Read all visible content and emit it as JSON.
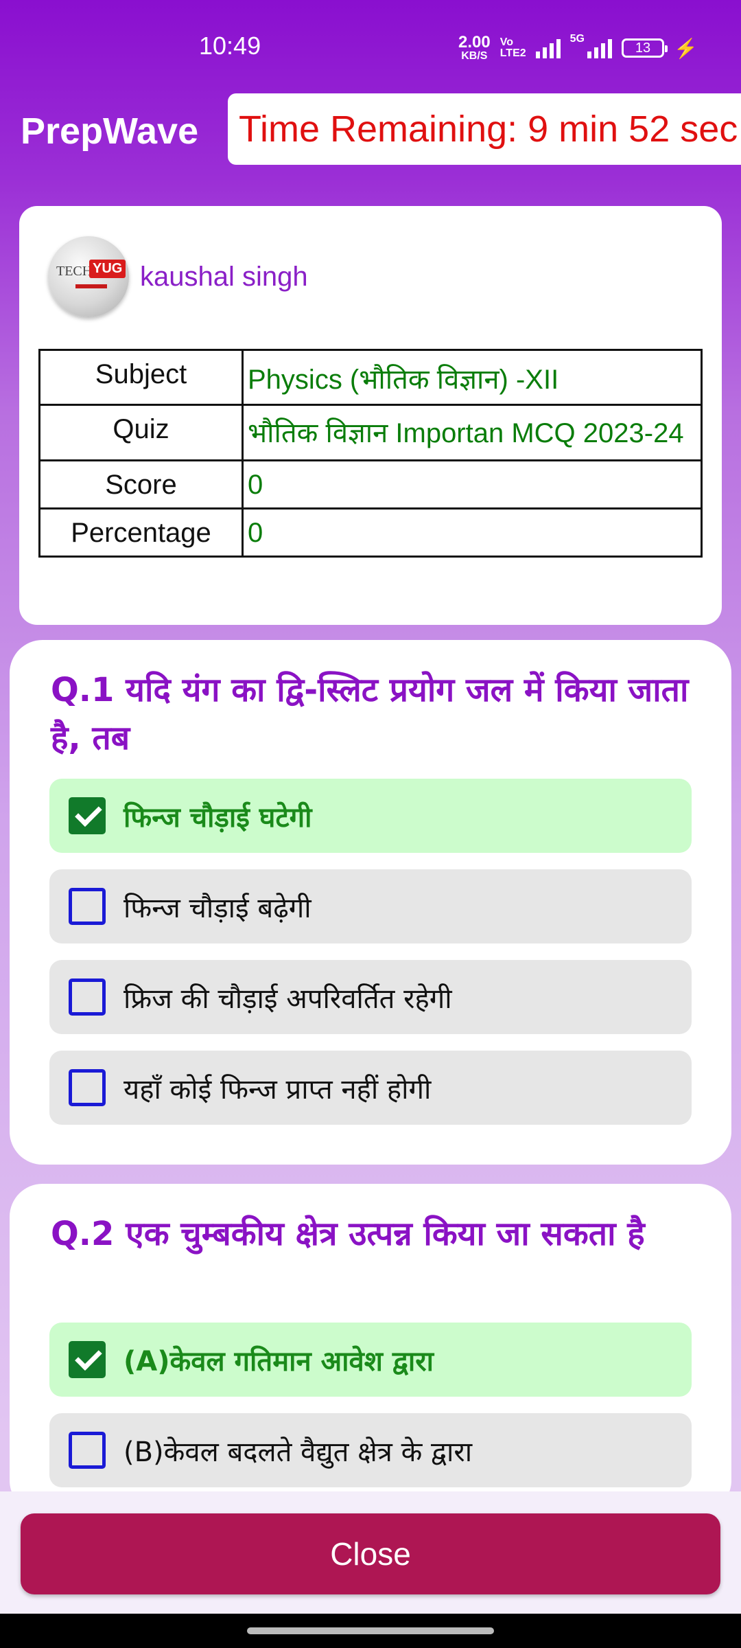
{
  "status_bar": {
    "time": "10:49",
    "net_speed_value": "2.00",
    "net_speed_unit": "KB/S",
    "volte_top": "Vo",
    "volte_bottom": "LTE2",
    "network_type": "5G",
    "battery_level": "13"
  },
  "header": {
    "app_title": "PrepWave",
    "timer_text": "Time Remaining: 9 min 52 sec"
  },
  "profile": {
    "avatar_text_tech": "TECH",
    "avatar_text_yug": "YUG",
    "name": "kaushal singh"
  },
  "info_table": [
    {
      "label": "Subject",
      "value": "Physics (भौतिक विज्ञान) -XII"
    },
    {
      "label": "Quiz",
      "value": "भौतिक विज्ञान Importan MCQ 2023-24"
    },
    {
      "label": "Score",
      "value": "0"
    },
    {
      "label": "Percentage",
      "value": "0"
    }
  ],
  "questions": [
    {
      "title": "Q.1 यदि यंग का द्वि-स्लिट प्रयोग जल में किया जाता है, तब",
      "options": [
        {
          "label": "फिन्ज चौड़ाई घटेगी",
          "checked": true
        },
        {
          "label": "फिन्ज चौड़ाई बढ़ेगी",
          "checked": false
        },
        {
          "label": "फ्रिज की चौड़ाई अपरिवर्तित रहेगी",
          "checked": false
        },
        {
          "label": "यहाँ कोई फिन्ज प्राप्त नहीं होगी",
          "checked": false
        }
      ]
    },
    {
      "title": "Q.2 एक चुम्बकीय क्षेत्र उत्पन्न किया जा सकता है",
      "options": [
        {
          "label": "(A)केवल गतिमान आवेश द्वारा",
          "checked": true
        },
        {
          "label": "(B)केवल बदलते वैद्युत क्षेत्र के द्वारा",
          "checked": false
        }
      ]
    }
  ],
  "footer": {
    "close_label": "Close"
  },
  "colors": {
    "header_purple": "#8a0fcf",
    "timer_red": "#e01010",
    "question_purple": "#8a12c4",
    "selected_bg": "#ccfccc",
    "checkbox_blue": "#1a1ad6",
    "checkbox_checked": "#117a2a",
    "close_button": "#ae1653"
  }
}
